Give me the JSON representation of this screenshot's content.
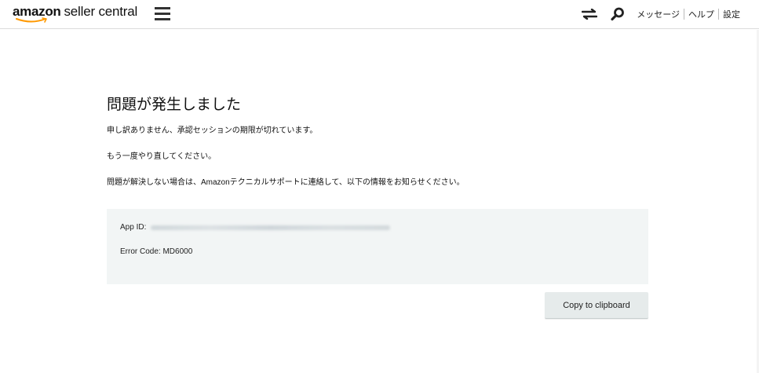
{
  "header": {
    "logo": {
      "brand": "amazon",
      "rest": "seller central"
    },
    "nav": {
      "messages": "メッセージ",
      "help": "ヘルプ",
      "settings": "設定"
    },
    "icons": {
      "menu": "hamburger-icon",
      "switch": "swap-arrows-icon",
      "search": "search-icon"
    }
  },
  "main": {
    "title": "問題が発生しました",
    "paragraphs": [
      "申し訳ありません、承認セッションの期限が切れています。",
      "もう一度やり直してください。",
      "問題が解決しない場合は、Amazonテクニカルサポートに連絡して、以下の情報をお知らせください。"
    ],
    "info": {
      "app_id_label": "App ID:",
      "error_code": "Error Code: MD6000"
    },
    "copy_button": "Copy to clipboard"
  },
  "colors": {
    "brand_smile": "#ff9900",
    "info_box_bg": "#f2f5f5",
    "button_bg": "#e6ebeb"
  }
}
